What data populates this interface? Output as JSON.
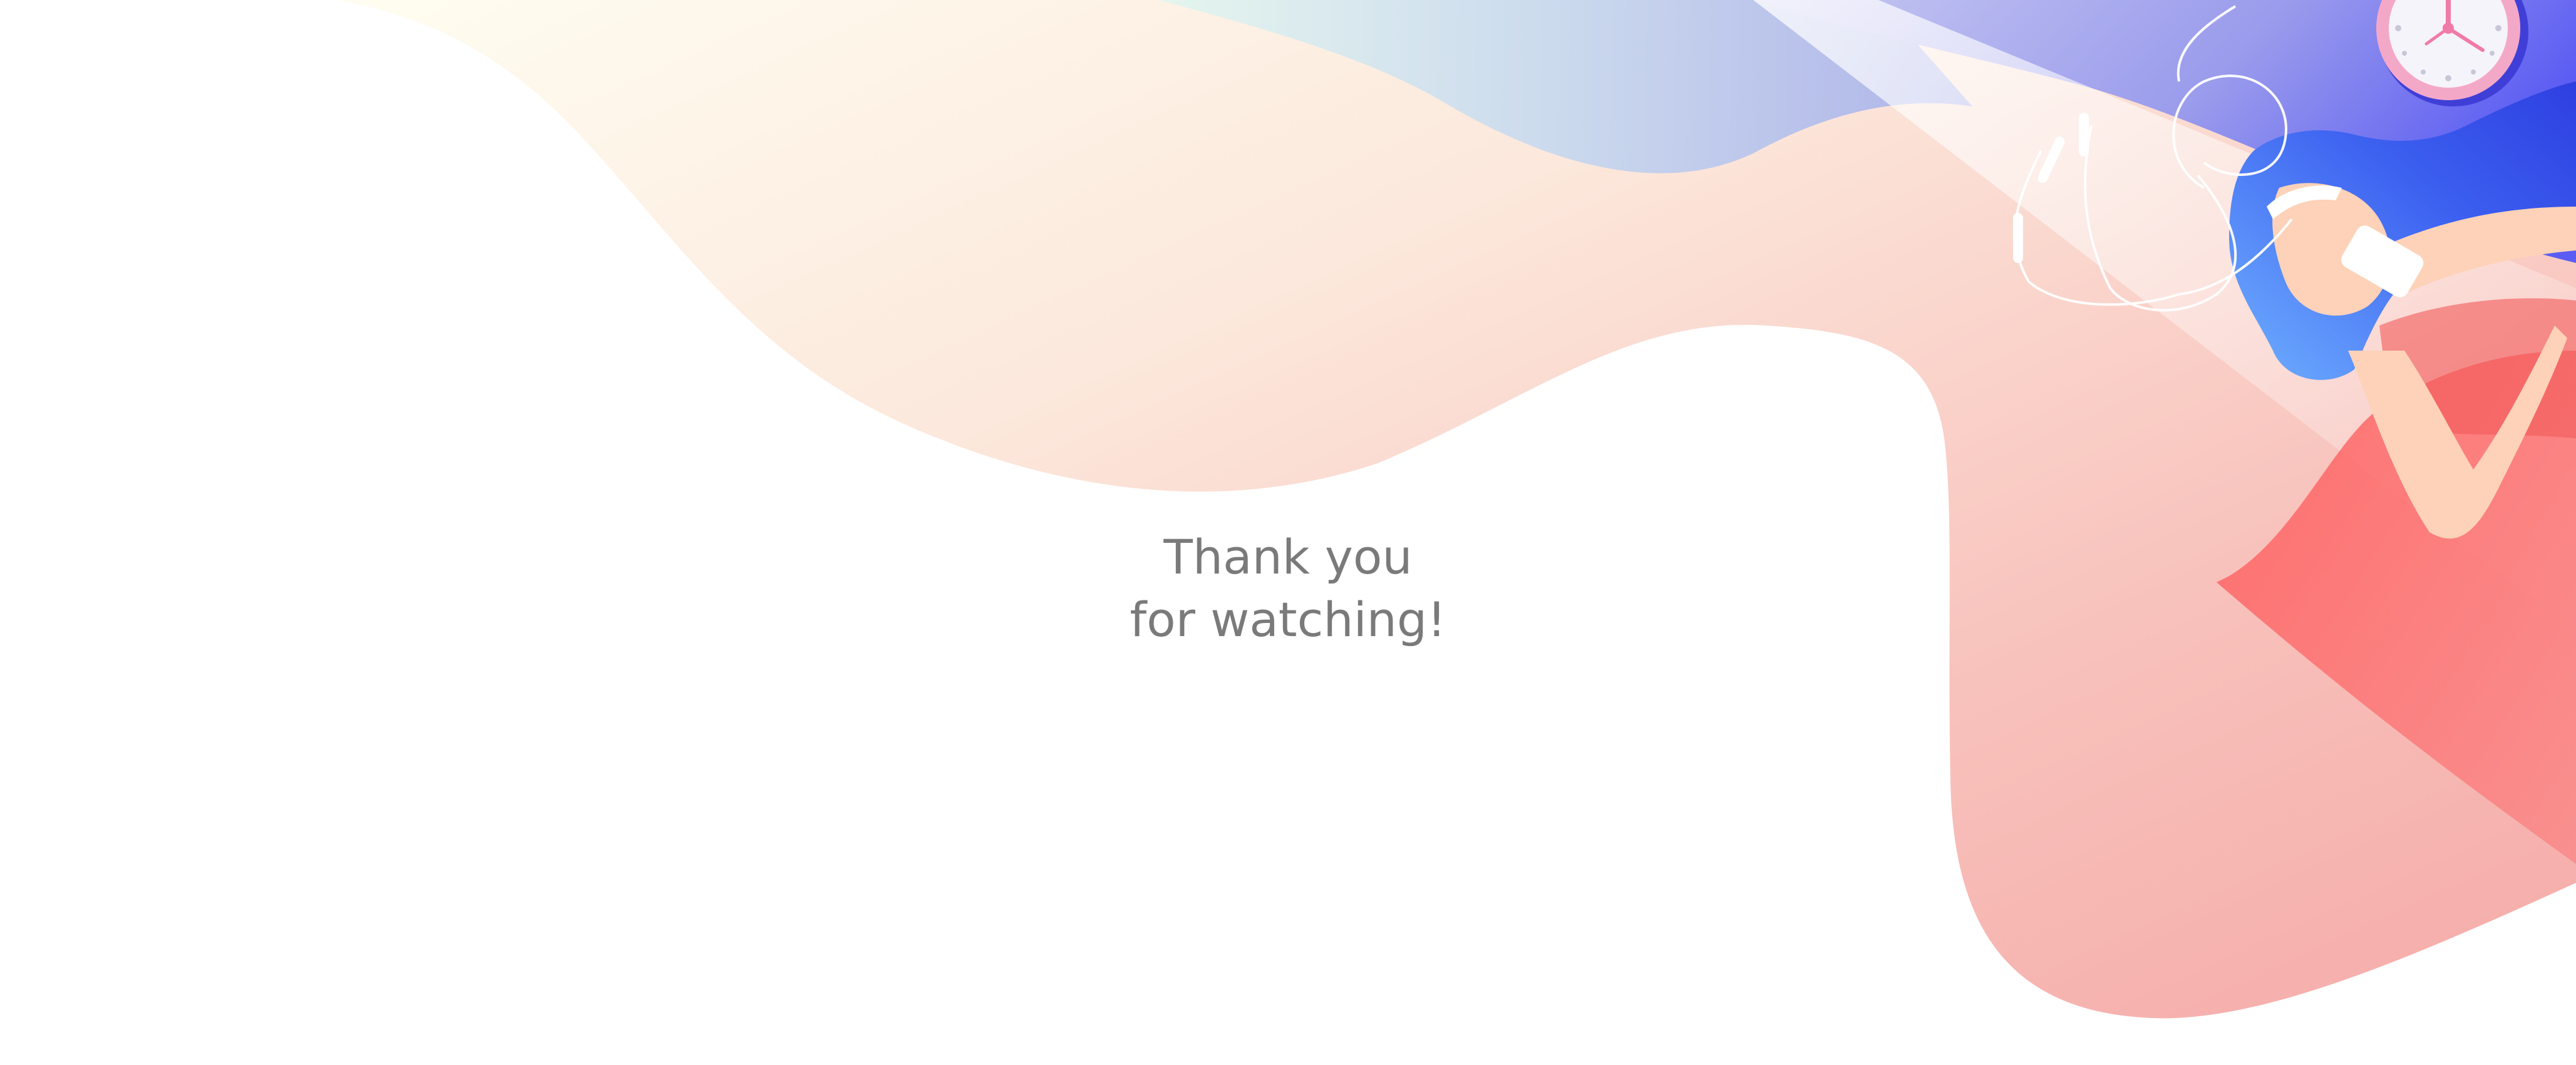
{
  "slide": {
    "message_line_1": "Thank you",
    "message_line_2": "for watching!"
  },
  "illustration": {
    "subject": "woman-lying-listening-to-music",
    "elements": [
      "wall-clock-icon",
      "earphones-icon",
      "phone-icon"
    ]
  },
  "colors": {
    "text": "#7a7a7a",
    "coral": "#f6a3a0",
    "peach": "#fbe3d8",
    "cream": "#fffbee",
    "mint": "#d9f2ea",
    "periwinkle": "#8f8fe6",
    "indigo": "#4b55f2",
    "skin": "#fdd2b8",
    "dress": "#f25a5a",
    "clock_ring": "#f4a8c8"
  }
}
